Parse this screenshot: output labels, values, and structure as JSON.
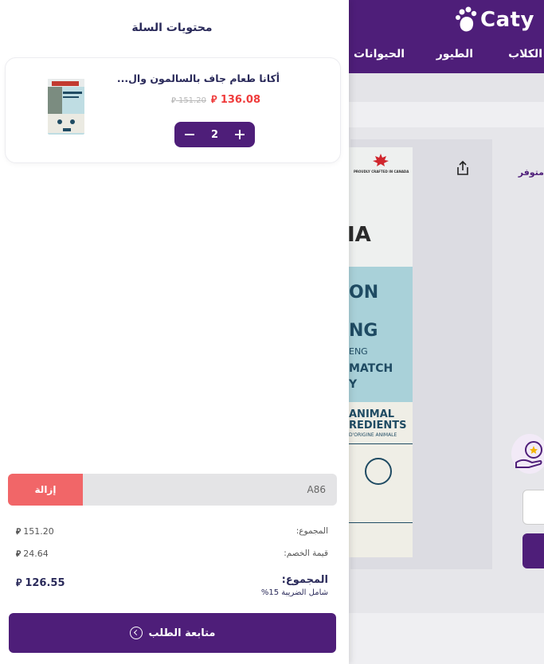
{
  "site": {
    "logo_text": "Caty",
    "nav": [
      "الكلاب",
      "الطيور",
      "الحيوانات الـ"
    ],
    "availability_text": "متوفر"
  },
  "product_bag": {
    "brand_fragment": "IA",
    "lines": [
      "ON",
      "NG",
      "ENG",
      "MATCH",
      "Y",
      "ANIMAL",
      "REDIENTS",
      "D'ORIGINE ANIMALE"
    ],
    "badge": "PROUDLY CRAFTED IN CANADA"
  },
  "cart": {
    "title": "محتويات السلة",
    "item": {
      "name": "أكانا طعام جاف بالسالمون وال...",
      "old_price": "151.20",
      "new_price": "136.08",
      "currency_symbol": "⃁",
      "quantity": "2"
    },
    "coupon": {
      "value": "A86",
      "remove_label": "إزالة"
    },
    "summary": {
      "subtotal_label": "المجموع:",
      "subtotal_value": "151.20",
      "discount_label": "قيمة الخصم:",
      "discount_value": "24.64",
      "total_label": "المجموع:",
      "total_value": "126.55",
      "tax_note": "شامل الضريبة 15%"
    },
    "checkout_label": "متابعة الطلب"
  },
  "colors": {
    "primary": "#4e1e79",
    "price_red": "#ef3b3b",
    "remove_red": "#f16668"
  }
}
